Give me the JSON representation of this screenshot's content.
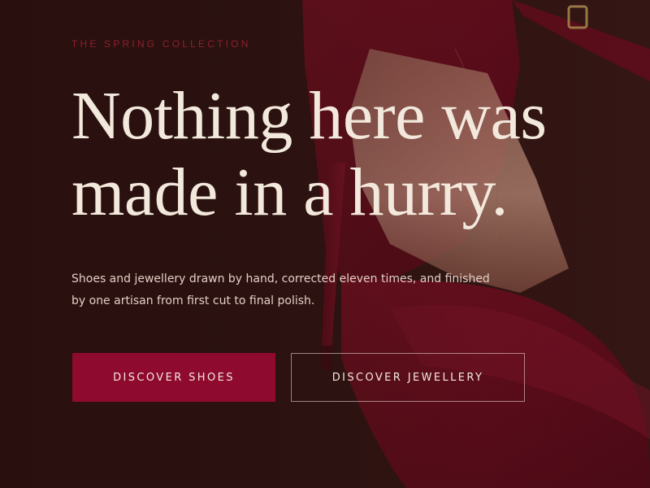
{
  "hero": {
    "eyebrow": "THE SPRING COLLECTION",
    "headline_line1": "Nothing here was",
    "headline_line2": "made in a hurry.",
    "lede": "Shoes and jewellery drawn by hand, corrected eleven times, and finished by one artisan from first cut to final polish.",
    "image_icon": "red-high-heel-shoe-photo"
  },
  "actions": {
    "primary_label": "DISCOVER SHOES",
    "secondary_label": "DISCOVER JEWELLERY"
  },
  "colors": {
    "background": "#2b1210",
    "accent": "#8e0a2f",
    "eyebrow": "#8d1f2e",
    "headline": "#f3e8dc",
    "body_text": "#e3cfc6"
  }
}
